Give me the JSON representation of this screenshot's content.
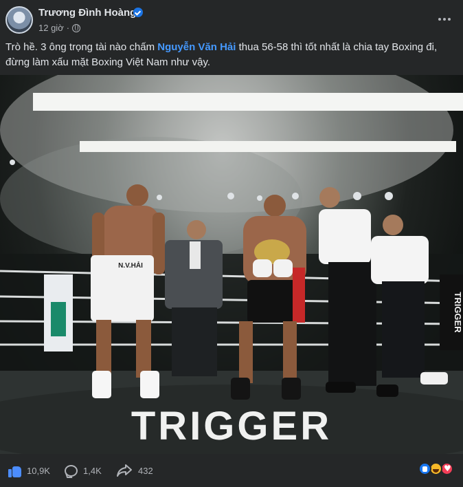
{
  "post": {
    "author": "Trương Đình Hoàng",
    "time": "12 giờ",
    "text_before": "Trò hề. 3 ông trọng tài nào chấm ",
    "mention": "Nguyễn Văn Hải",
    "text_after": " thua 56-58 thì tốt nhất là chia tay Boxing đi, đừng làm xấu mặt Boxing Việt Nam như vậy."
  },
  "photo": {
    "ring_floor_text": "TRIGGER",
    "banner_text": "TRIGGER",
    "trunks_text": "N.V.HẢI",
    "colors": {
      "background": "#252728",
      "link": "#4599ff",
      "secondary_text": "#b0b3b8"
    }
  },
  "footer": {
    "likes": "10,9K",
    "comments": "1,4K",
    "shares": "432",
    "reactions": [
      "like-icon",
      "haha-icon",
      "love-icon"
    ]
  }
}
